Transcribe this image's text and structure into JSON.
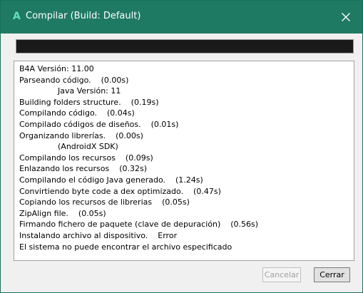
{
  "window": {
    "app_icon_letter": "A",
    "title": "Compilar (Build: Default)",
    "accent_color": "#1f7a63"
  },
  "progress": {
    "value": 0
  },
  "log": {
    "lines": [
      {
        "text": "B4A Versión: 11.00",
        "indent": false
      },
      {
        "text": "Parseando código.    (0.00s)",
        "indent": false
      },
      {
        "text": "Java Versión: 11",
        "indent": true
      },
      {
        "text": "Building folders structure.    (0.19s)",
        "indent": false
      },
      {
        "text": "Compilando código.    (0.04s)",
        "indent": false
      },
      {
        "text": "Compilado códigos de diseños.    (0.01s)",
        "indent": false
      },
      {
        "text": "Organizando librerías.    (0.00s)",
        "indent": false
      },
      {
        "text": "(AndroidX SDK)",
        "indent": true
      },
      {
        "text": "Compilando los recursos    (0.09s)",
        "indent": false
      },
      {
        "text": "Enlazando los recursos    (0.32s)",
        "indent": false
      },
      {
        "text": "Compilando el código Java generado.    (1.24s)",
        "indent": false
      },
      {
        "text": "Convirtiendo byte code a dex optimizado.    (0.47s)",
        "indent": false
      },
      {
        "text": "Copiando los recursos de librerias    (0.05s)",
        "indent": false
      },
      {
        "text": "ZipAlign file.    (0.05s)",
        "indent": false
      },
      {
        "text": "Firmando fichero de paquete (clave de depuración)    (0.56s)",
        "indent": false
      },
      {
        "text": "Instalando archivo al dispositivo.    Error",
        "indent": false
      },
      {
        "text": "El sistema no puede encontrar el archivo especificado",
        "indent": false
      }
    ]
  },
  "buttons": {
    "cancel_label": "Cancelar",
    "close_label": "Cerrar"
  }
}
